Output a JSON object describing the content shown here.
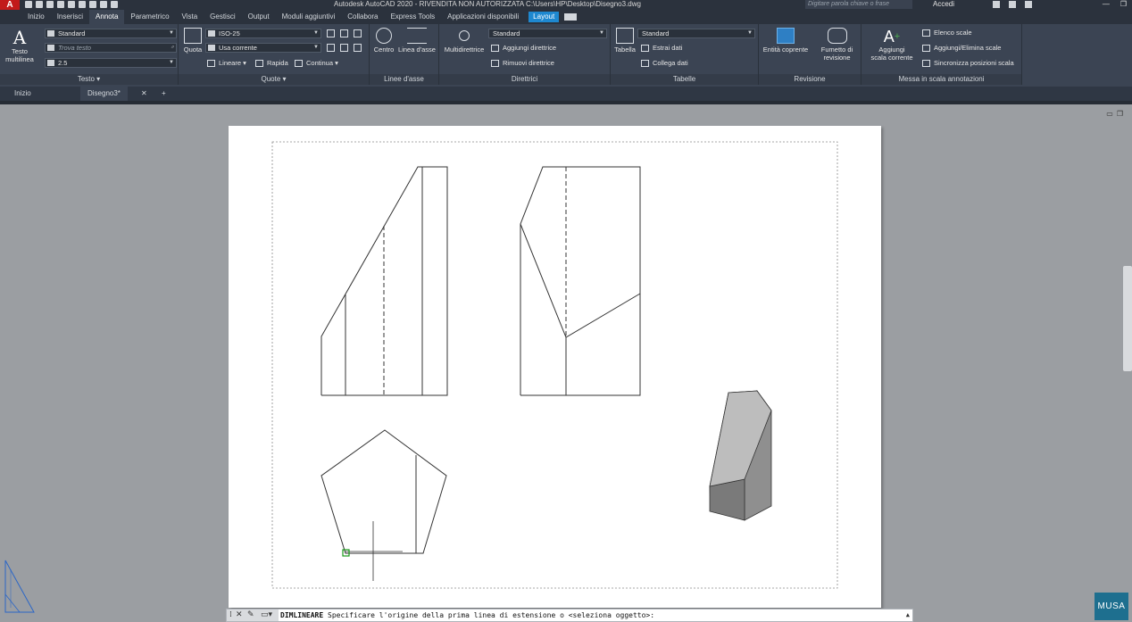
{
  "titlebar": {
    "logo": "A",
    "title": "Autodesk AutoCAD 2020 - RIVENDITA NON AUTORIZZATA    C:\\Users\\HP\\Desktop\\Disegno3.dwg",
    "search_placeholder": "Digitare parola chiave o frase",
    "signin": "Accedi"
  },
  "ribbon_tabs": [
    "Inizio",
    "Inserisci",
    "Annota",
    "Parametrico",
    "Vista",
    "Gestisci",
    "Output",
    "Moduli aggiuntivi",
    "Collabora",
    "Express Tools",
    "Applicazioni disponibili"
  ],
  "active_tab": "Annota",
  "layout_tab": "Layout",
  "panels": {
    "testo": {
      "title": "Testo",
      "multiline_label_1": "Testo",
      "multiline_label_2": "multilinea",
      "style": "Standard",
      "find_placeholder": "Trova testo",
      "height": "2.5"
    },
    "quote": {
      "title": "Quote",
      "quota_label": "Quota",
      "dimstyle": "ISO-25",
      "layer": "Usa corrente",
      "lineare": "Lineare",
      "rapida": "Rapida",
      "continua": "Continua"
    },
    "linee_asse": {
      "title": "Linee d'asse",
      "centro": "Centro",
      "linea_asse": "Linea d'asse"
    },
    "direttrici": {
      "title": "Direttrici",
      "multidirettrice": "Multidirettrice",
      "style": "Standard",
      "aggiungi": "Aggiungi direttrice",
      "rimuovi": "Rimuovi direttrice"
    },
    "tabelle": {
      "title": "Tabelle",
      "tabella": "Tabella",
      "style": "Standard",
      "estrai": "Estrai dati",
      "collega": "Collega dati"
    },
    "revisione": {
      "title": "Revisione",
      "entita": "Entità coprente",
      "fumetto_1": "Fumetto di",
      "fumetto_2": "revisione"
    },
    "scala": {
      "title": "Messa in scala annotazioni",
      "aggiungi_1": "Aggiungi",
      "aggiungi_2": "scala corrente",
      "elenco": "Elenco scale",
      "aggiungi_elimina": "Aggiungi/Elimina scale",
      "sincronizza": "Sincronizza posizioni scala"
    }
  },
  "file_tabs": {
    "start": "Inizio",
    "doc": "Disegno3*"
  },
  "command_line": {
    "command": "DIMLINEARE",
    "prompt": "Specificare l'origine della prima linea di estensione o <seleziona oggetto>:"
  },
  "watermark": "MUSA",
  "colors": {
    "layout_tab": "#1e88d0",
    "ribbon_bg": "#3b4453",
    "workspace_bg": "#9b9ea2",
    "solid_light": "#b9b9b9",
    "solid_dark": "#8a8a8a",
    "snap_marker": "#1a9a1a"
  }
}
